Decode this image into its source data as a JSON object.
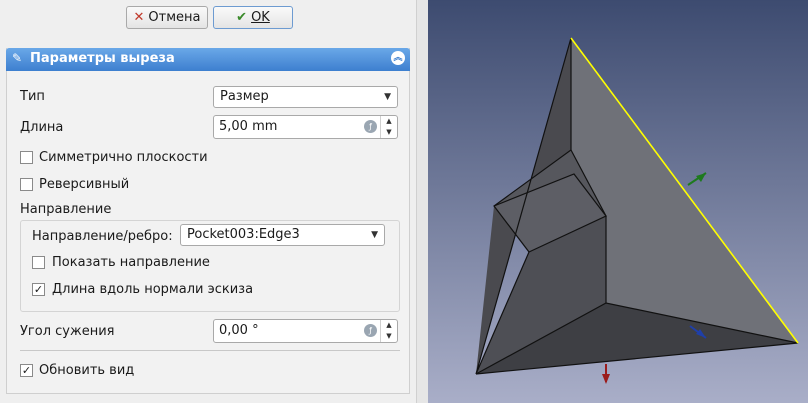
{
  "toolbar": {
    "cancel_label": "Отмена",
    "ok_label": "OK"
  },
  "section": {
    "title": "Параметры выреза"
  },
  "form": {
    "type_label": "Тип",
    "type_value": "Размер",
    "length_label": "Длина",
    "length_value": "5,00 mm",
    "symmetric_label": "Симметрично плоскости",
    "reversed_label": "Реверсивный",
    "direction_heading": "Направление",
    "direction_edge_label": "Направление/ребро:",
    "direction_edge_value": "Pocket003:Edge3",
    "show_direction_label": "Показать направление",
    "along_normal_label": "Длина вдоль нормали эскиза",
    "taper_label": "Угол сужения",
    "taper_value": "0,00 °",
    "update_view_label": "Обновить вид"
  },
  "checks": {
    "symmetric": false,
    "reversed": false,
    "show_direction": false,
    "along_normal": true,
    "update_view": true
  },
  "icons": {
    "cancel": "x-icon",
    "ok": "check-icon",
    "section": "pocket-icon",
    "collapse": "chevron-up-icon",
    "unit": "expression-icon"
  },
  "colors": {
    "header": "#4a8cdb",
    "viewport_top": "#3d4b70",
    "viewport_bottom": "#a9aec8",
    "selected_edge": "#ffff00"
  }
}
